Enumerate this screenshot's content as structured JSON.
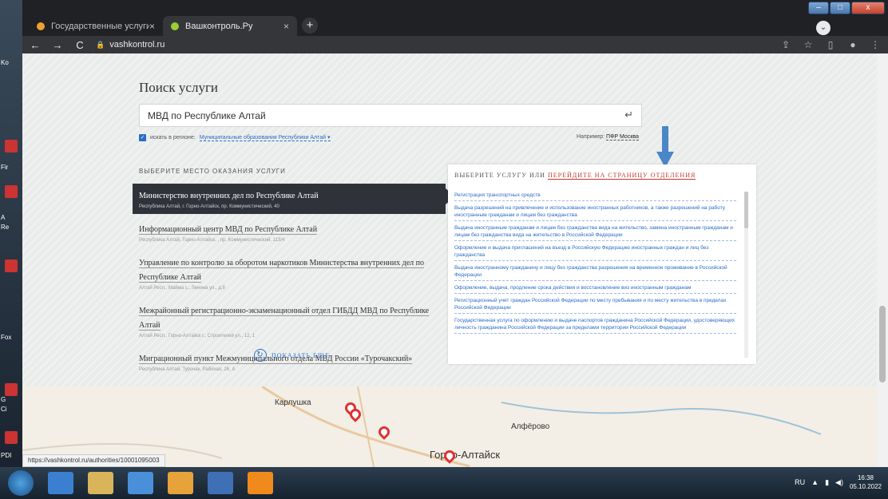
{
  "desktop": {
    "labels": [
      "Ko",
      "Fir",
      "A",
      "Re",
      "Fox",
      "G",
      "Ci",
      "PDI"
    ]
  },
  "browser": {
    "tabs": [
      {
        "label": "Государственные услуги",
        "favicon_color": "#f0a030"
      },
      {
        "label": "Вашконтроль.Ру",
        "favicon_color": "#9acd32"
      }
    ],
    "new_tab": "+",
    "window_controls": [
      "–",
      "□",
      "x"
    ],
    "url": "vashkontrol.ru",
    "status_url": "https://vashkontrol.ru/authorities/10001095003"
  },
  "page": {
    "title": "Поиск услуги",
    "search_value": "МВД по Республике Алтай",
    "region_label": "искать в регионе:",
    "region_value": "Муниципальные образования Республики Алтай",
    "example_label": "Например:",
    "example_value": "ПФР Москва",
    "places_heading": "ВЫБЕРИТЕ МЕСТО ОКАЗАНИЯ УСЛУГИ",
    "places": [
      {
        "name": "Министерство внутренних дел по Республике Алтай",
        "address": "Республика Алтай, г. Горно-Алтайск, пр. Коммунистический, 40"
      },
      {
        "name": "Информационный центр МВД по Республике Алтай",
        "address": "Республика Алтай, Горно-Алтайск, , пр. Коммунистический, 113/4"
      },
      {
        "name": "Управление по контролю за оборотом наркотиков Министерства внутренних дел по Республике Алтай",
        "address": "Алтай Респ., Майма с., Ленина ул., д.8"
      },
      {
        "name": "Межрайонный регистрационно-экзаменационный отдел ГИБДД МВД по Республике Алтай",
        "address": "Алтай Респ., Горно-Алтайск г., Строителей ул., 12, 1"
      },
      {
        "name": "Миграционный пункт Межмуниципального отдела МВД России «Турочакский»",
        "address": "Республика Алтай, Турочак, Рабочая, 26, А"
      }
    ],
    "show_more": "ПОКАЗАТЬ ЕЩЕ",
    "services_heading_prefix": "ВЫБЕРИТЕ УСЛУГУ ИЛИ",
    "services_heading_link": "ПЕРЕЙДИТЕ НА СТРАНИЦУ ОТДЕЛЕНИЯ",
    "services": [
      "Регистрация транспортных средств",
      "Выдача разрешений на привлечение и использование иностранных работников, а также разрешений на работу иностранным гражданам и лицам без гражданства",
      "Выдача иностранным гражданам и лицам без гражданства вида на жительство, замена иностранным гражданам и лицам без гражданства вида на жительство в Российской Федерации",
      "Оформление и выдача приглашений на въезд в Российскую Федерацию иностранных граждан и лиц без гражданства",
      "Выдача иностранному гражданину и лицу без гражданства разрешения на временное проживание в Российской Федерации",
      "Оформление, выдача, продление срока действия и восстановление виз иностранным гражданам",
      "Регистрационный учет граждан Российской Федерации по месту пребывания и по месту жительства в пределах Российской Федерации",
      "Государственная услуга по оформлению и выдаче паспортов гражданина Российской Федерации, удостоверяющих личность гражданина Российской Федерации за пределами территории Российской Федерации"
    ],
    "map_labels": [
      "Карлушка",
      "Алфёрово",
      "Горно-Алтайск"
    ]
  },
  "taskbar": {
    "lang": "RU",
    "time": "16:38",
    "date": "05.10.2022"
  }
}
